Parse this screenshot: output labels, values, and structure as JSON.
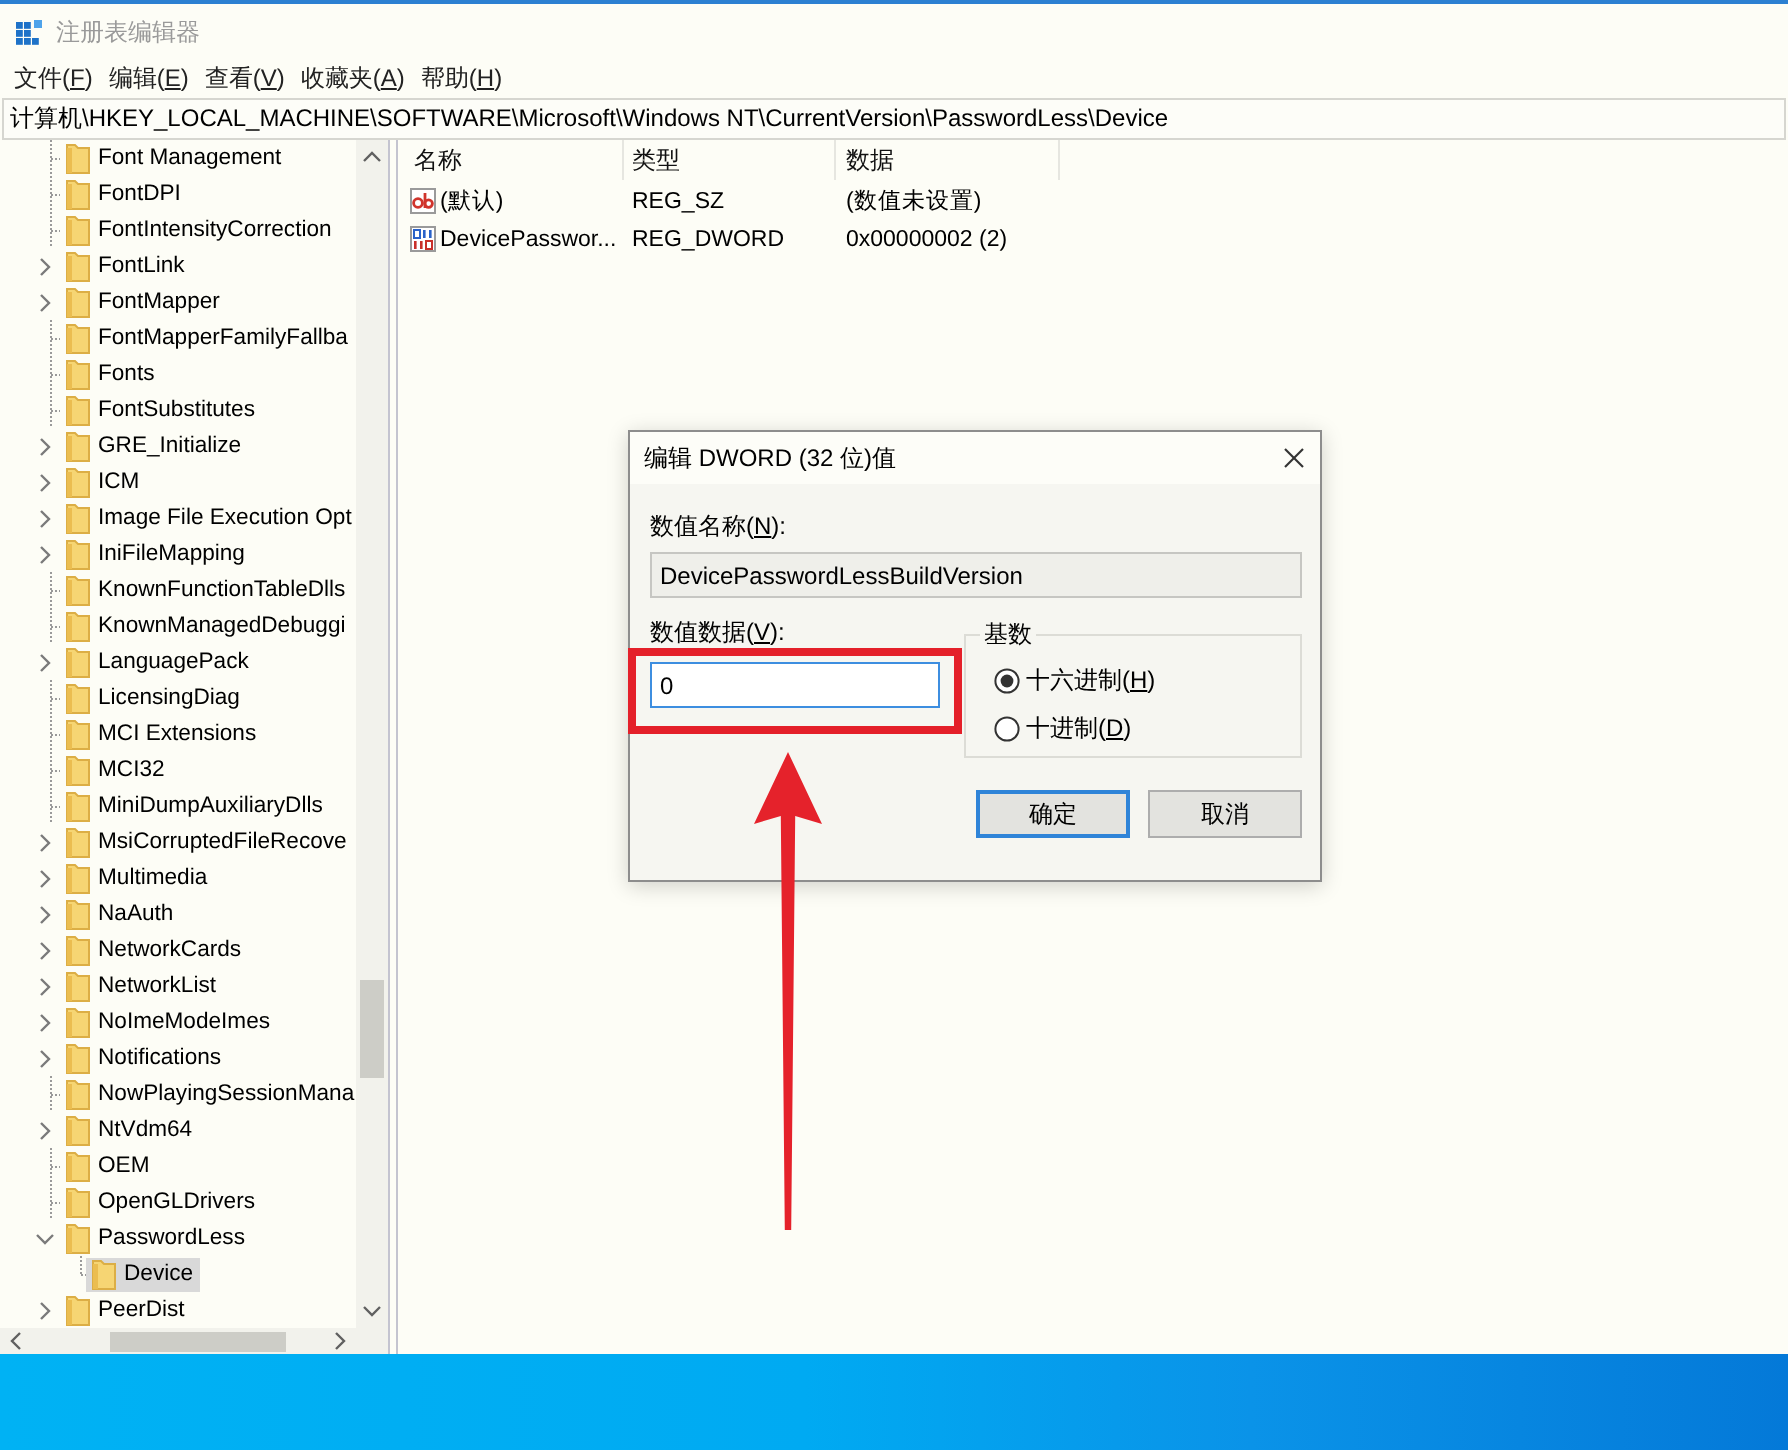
{
  "window": {
    "title": "注册表编辑器"
  },
  "menu": [
    {
      "text": "文件(",
      "key": "F",
      "end": ")"
    },
    {
      "text": "编辑(",
      "key": "E",
      "end": ")"
    },
    {
      "text": "查看(",
      "key": "V",
      "end": ")"
    },
    {
      "text": "收藏夹(",
      "key": "A",
      "end": ")"
    },
    {
      "text": "帮助(",
      "key": "H",
      "end": ")"
    }
  ],
  "address_bar": {
    "path": "计算机\\HKEY_LOCAL_MACHINE\\SOFTWARE\\Microsoft\\Windows NT\\CurrentVersion\\PasswordLess\\Device"
  },
  "tree": {
    "items": [
      {
        "label": "Font Management",
        "kind": "leaf",
        "expanded": false,
        "selected": false
      },
      {
        "label": "FontDPI",
        "kind": "leaf",
        "expanded": false,
        "selected": false
      },
      {
        "label": "FontIntensityCorrection",
        "kind": "leaf",
        "expanded": false,
        "selected": false
      },
      {
        "label": "FontLink",
        "kind": "branch",
        "expanded": false,
        "selected": false
      },
      {
        "label": "FontMapper",
        "kind": "branch",
        "expanded": false,
        "selected": false
      },
      {
        "label": "FontMapperFamilyFallba",
        "kind": "leaf",
        "expanded": false,
        "selected": false
      },
      {
        "label": "Fonts",
        "kind": "leaf",
        "expanded": false,
        "selected": false
      },
      {
        "label": "FontSubstitutes",
        "kind": "leaf",
        "expanded": false,
        "selected": false
      },
      {
        "label": "GRE_Initialize",
        "kind": "branch",
        "expanded": false,
        "selected": false
      },
      {
        "label": "ICM",
        "kind": "branch",
        "expanded": false,
        "selected": false
      },
      {
        "label": "Image File Execution Opt",
        "kind": "branch",
        "expanded": false,
        "selected": false
      },
      {
        "label": "IniFileMapping",
        "kind": "branch",
        "expanded": false,
        "selected": false
      },
      {
        "label": "KnownFunctionTableDlls",
        "kind": "leaf",
        "expanded": false,
        "selected": false
      },
      {
        "label": "KnownManagedDebuggi",
        "kind": "leaf",
        "expanded": false,
        "selected": false
      },
      {
        "label": "LanguagePack",
        "kind": "branch",
        "expanded": false,
        "selected": false
      },
      {
        "label": "LicensingDiag",
        "kind": "leaf",
        "expanded": false,
        "selected": false
      },
      {
        "label": "MCI Extensions",
        "kind": "leaf",
        "expanded": false,
        "selected": false
      },
      {
        "label": "MCI32",
        "kind": "leaf",
        "expanded": false,
        "selected": false
      },
      {
        "label": "MiniDumpAuxiliaryDlls",
        "kind": "leaf",
        "expanded": false,
        "selected": false
      },
      {
        "label": "MsiCorruptedFileRecove",
        "kind": "branch",
        "expanded": false,
        "selected": false
      },
      {
        "label": "Multimedia",
        "kind": "branch",
        "expanded": false,
        "selected": false
      },
      {
        "label": "NaAuth",
        "kind": "branch",
        "expanded": false,
        "selected": false
      },
      {
        "label": "NetworkCards",
        "kind": "branch",
        "expanded": false,
        "selected": false
      },
      {
        "label": "NetworkList",
        "kind": "branch",
        "expanded": false,
        "selected": false
      },
      {
        "label": "NoImeModeImes",
        "kind": "branch",
        "expanded": false,
        "selected": false
      },
      {
        "label": "Notifications",
        "kind": "branch",
        "expanded": false,
        "selected": false
      },
      {
        "label": "NowPlayingSessionMana",
        "kind": "leaf",
        "expanded": false,
        "selected": false
      },
      {
        "label": "NtVdm64",
        "kind": "branch",
        "expanded": false,
        "selected": false
      },
      {
        "label": "OEM",
        "kind": "leaf",
        "expanded": false,
        "selected": false
      },
      {
        "label": "OpenGLDrivers",
        "kind": "leaf",
        "expanded": false,
        "selected": false
      },
      {
        "label": "PasswordLess",
        "kind": "branch",
        "expanded": true,
        "selected": false,
        "children": [
          {
            "label": "Device",
            "kind": "leaf",
            "expanded": false,
            "selected": true
          }
        ]
      },
      {
        "label": "PeerDist",
        "kind": "branch",
        "expanded": false,
        "selected": false
      }
    ]
  },
  "list": {
    "columns": [
      "名称",
      "类型",
      "数据"
    ],
    "rows": [
      {
        "kind": "string",
        "name": "(默认)",
        "type": "REG_SZ",
        "data": "(数值未设置)"
      },
      {
        "kind": "dword",
        "name": "DevicePasswor...",
        "type": "REG_DWORD",
        "data": "0x00000002 (2)"
      }
    ]
  },
  "dialog": {
    "title": "编辑 DWORD (32 位)值",
    "name_label": {
      "text": "数值名称(",
      "key": "N",
      "end": "):"
    },
    "name_value": "DevicePasswordLessBuildVersion",
    "data_label": {
      "text": "数值数据(",
      "key": "V",
      "end": "):"
    },
    "data_value": "0",
    "base_label": "基数",
    "bases": [
      {
        "text": "十六进制(",
        "key": "H",
        "end": ")",
        "selected": true
      },
      {
        "text": "十进制(",
        "key": "D",
        "end": ")",
        "selected": false
      }
    ],
    "buttons": [
      {
        "label": "确定",
        "default": true
      },
      {
        "label": "取消",
        "default": false
      }
    ]
  }
}
